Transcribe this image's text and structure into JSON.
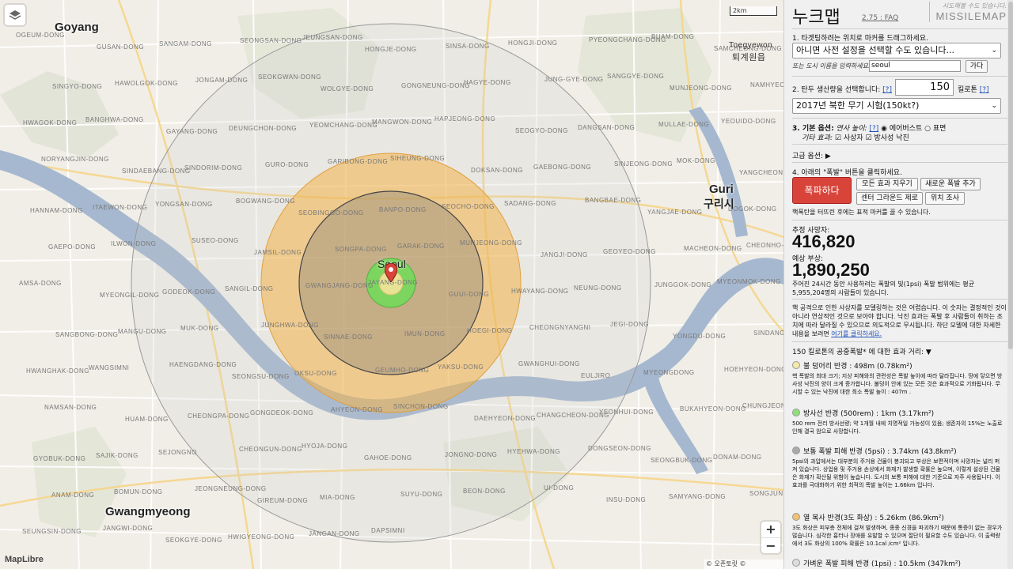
{
  "map": {
    "cities": {
      "goyang": "Goyang",
      "gwangmyeong": "Gwangmyeong",
      "guri_en": "Guri",
      "guri_ko": "구리시",
      "toegyewon_en": "Toegyewon",
      "toegyewon_ko": "퇴계원읍",
      "seoul": "Seoul"
    },
    "districts": [
      "OGEUM-DONG",
      "GUSAN-DONG",
      "SANGAM-DONG",
      "SEONGSAN-DONG",
      "JEUNGSAN-DONG",
      "HONGJE-DONG",
      "SINSA-DONG",
      "HONGJI-DONG",
      "PYEONGCHANG-DONG",
      "BUAM-DONG",
      "SAMCHEONG-DONG",
      "SINGYO-DONG",
      "HAWOLGOK-DONG",
      "JONGAM-DONG",
      "SEOKGWAN-DONG",
      "WOLGYE-DONG",
      "GONGNEUNG-DONG",
      "HAGYE-DONG",
      "JUNG-GYE-DONG",
      "SANGGYE-DONG",
      "MUNJEONG-DONG",
      "NAMHYEON-DONG",
      "HWAGOK-DONG",
      "BANGHWA-DONG",
      "GAYANG-DONG",
      "DEUNGCHON-DONG",
      "YEOMCHANG-DONG",
      "MANGWON-DONG",
      "HAPJEONG-DONG",
      "SEOGYO-DONG",
      "DANGSAN-DONG",
      "MULLAE-DONG",
      "YEOUIDO-DONG",
      "NORYANGJIN-DONG",
      "SINDAEBANG-DONG",
      "SINDORIM-DONG",
      "GURO-DONG",
      "GARIBONG-DONG",
      "SIHEUNG-DONG",
      "DOKSAN-DONG",
      "GAEBONG-DONG",
      "SINJEONG-DONG",
      "MOK-DONG",
      "YANGCHEON-GU",
      "HANNAM-DONG",
      "ITAEWON-DONG",
      "YONGSAN-DONG",
      "BOGWANG-DONG",
      "SEOBINGGO-DONG",
      "BANPO-DONG",
      "SEOCHO-DONG",
      "SADANG-DONG",
      "BANGBAE-DONG",
      "YANGJAE-DONG",
      "DOGOK-DONG",
      "GAEPO-DONG",
      "ILWON-DONG",
      "SUSEO-DONG",
      "JAMSIL-DONG",
      "SONGPA-DONG",
      "GARAK-DONG",
      "MUNJEONG-DONG",
      "JANGJI-DONG",
      "GEOYEO-DONG",
      "MACHEON-DONG",
      "CHEONHO-DONG",
      "AMSA-DONG",
      "MYEONGIL-DONG",
      "GODEOK-DONG",
      "SANGIL-DONG",
      "GWANGJANG-DONG",
      "JAYANG-DONG",
      "GUUI-DONG",
      "HWAYANG-DONG",
      "NEUNG-DONG",
      "JUNGGOK-DONG",
      "MYEONMOK-DONG",
      "SANGBONG-DONG",
      "MANGU-DONG",
      "MUK-DONG",
      "JUNGHWA-DONG",
      "SINNAE-DONG",
      "IMUN-DONG",
      "HOEGI-DONG",
      "CHEONGNYANGNI",
      "JEGI-DONG",
      "YONGDU-DONG",
      "SINDANG-DONG",
      "HWANGHAK-DONG",
      "WANGSIMNI",
      "HAENGDANG-DONG",
      "SEONGSU-DONG",
      "OKSU-DONG",
      "GEUMHO-DONG",
      "YAKSU-DONG",
      "GWANGHUI-DONG",
      "EULJIRO",
      "MYEONGDONG",
      "HOEHYEON-DONG",
      "NAMSAN-DONG",
      "HUAM-DONG",
      "CHEONGPA-DONG",
      "GONGDEOK-DONG",
      "AHYEON-DONG",
      "SINCHON-DONG",
      "DAEHYEON-DONG",
      "CHANGCHEON-DONG",
      "YEONHUI-DONG",
      "BUKAHYEON-DONG",
      "CHUNGJEONG-RO",
      "GYOBUK-DONG",
      "SAJIK-DONG",
      "SEJONGNO",
      "CHEONGUN-DONG",
      "HYOJA-DONG",
      "GAHOE-DONG",
      "JONGNO-DONG",
      "HYEHWA-DONG",
      "DONGSEON-DONG",
      "SEONGBUK-DONG",
      "DONAM-DONG",
      "ANAM-DONG",
      "BOMUN-DONG",
      "JEONGNEUNG-DONG",
      "GIREUM-DONG",
      "MIA-DONG",
      "SUYU-DONG",
      "BEON-DONG",
      "UI-DONG",
      "INSU-DONG",
      "SAMYANG-DONG",
      "SONGJUNG-DONG",
      "SEUNGSIN-DONG",
      "JANGWI-DONG",
      "SEOKGYE-DONG",
      "HWIGYEONG-DONG",
      "JANGAN-DONG",
      "DAPSIMNI"
    ],
    "marker_icon": "pin-marker-icon",
    "layers_icon": "layers-icon",
    "scale_label": "2km",
    "attribution": "© 오픈토릿 © OpenStreetMap",
    "maplibre_label": "MapLibre",
    "zoom_in": "+",
    "zoom_out": "−"
  },
  "panel": {
    "title": "누크맵",
    "version": "2.75 : FAQ",
    "slogan": "시도해볼 수도 있습니다.",
    "brand": "MISSILEMAP",
    "step1": "1. 타겟팅하려는 위치로 마커를 드래그하세요.",
    "preset_select": "아니면 사전 설정을 선택할 수도 있습니다...",
    "city_hint": "또는 도시 이름을 입력하세요.",
    "city_value": "seoul",
    "go_button": "가다",
    "step2": "2. 탄두 생산량을 선택합니다:",
    "step2_help": "[?]",
    "yield_value": "150",
    "yield_unit": "킬로톤",
    "yield_unit_help": "[?]",
    "weapon_select": "2017년 북한 무기 시험(150kt?)",
    "step3": "3. 기본 옵션:",
    "burst_height_label": "연사 높이:",
    "burst_help": "[?]",
    "airburst": "에어버스트",
    "surface": "표면",
    "other_effects": "기타 효과:",
    "casualties": "사상자",
    "fallout": "방사성 낙진",
    "advanced": "고급 옵션:",
    "advanced_arrow": "▶",
    "step4": "4. 아래의 \"폭발\" 버튼을 클릭하세요.",
    "detonate": "폭파하다",
    "clear_effects": "모든 효과 지우기",
    "add_detonation": "새로운 폭발 추가",
    "center_gz": "센터 그라운드 제로",
    "probe": "위치 조사",
    "drag_hint": "핵폭탄을 터뜨린 후에는 표적 마커를 끌 수 있습니다.",
    "est_fatalities_label": "추정 사망자:",
    "est_fatalities": "416,820",
    "injuries_label": "예상 부상:",
    "injuries": "1,890,250",
    "population_note": "주어진 24시간 동안 사용하려는 폭발의 빛(1psi) 폭발 범위에는 평균 5,955,204명의 사람들이 있습니다.",
    "modeling_note": "핵 공격으로 인한 사상자를 모델링하는 것은 어렵습니다. 이 숫자는 결정적인 것이 아니라 연상적인 것으로 보아야 합니다. 낙진 효과는 폭발 후 사람들이 취하는 조치에 따라 달라질 수 있으므로 의도적으로 무시됩니다. 하단 모델에 대한 자세한 내용을 보려면",
    "modeling_link": "여기를 클릭하세요.",
    "effects_header": "150 킬로톤의 공중폭발* 에 대한 효과 거리: ▼",
    "effects": [
      {
        "color": "#f5e9a8",
        "title": "불 덩어리 반경 : 498m (0.78km²)",
        "desc": "핵 폭발의 최대 크기; 지상 피해와의 관련성은 폭발 높이에 따라 달라집니다. 땅에 닿으면 방사성 낙진의 양이 크게 증가합니다. 불덩이 안에 있는 모든 것은 효과적으로 기화됩니다. 무시할 수 있는 낙진에 대한 최소 폭발 높이 : 407m ."
      },
      {
        "color": "#8fe07a",
        "title": "방사선 반경 (500rem) : 1km (3.17km²)",
        "desc": "500 rem 전리 방사선량; 약 1개월 내에 치명적일 가능성이 있음; 생존자의 15%는 노출로 인해 결국 암으로 사망합니다."
      },
      {
        "color": "#aaaaaa",
        "title": "보통 폭발 피해 반경 (5psi) : 3.74km (43.8km²)",
        "desc": "5psi의 과압에서는 대부분의 주거용 건물이 붕괴되고 부상은 보편적이며 사망자는 널리 퍼져 있습니다. 상업용 및 주거용 손상에서 화재가 발생할 확률은 높으며, 이렇게 설상된 건물은 화재가 확산될 위험이 높습니다. 도시의 보통 피해에 대한 기준으로 자주 사용됩니다. 이 효과를 극대화하기 위한 최적의 폭발 높이는 1.66km 입니다."
      },
      {
        "color": "#f2c173",
        "title": "열 복사 반경(3도 화상) : 5.26km (86.9km²)",
        "desc": "3도 화상은 피부층 전체에 걸쳐 발생하며, 종종 신경을 파괴하기 때문에 통증이 없는 경우가 많습니다. 심각한 흉터나 장애를 유발할 수 있으며 절단이 필요할 수도 있습니다. 이 출력량에서 3도 화상의 100% 확률은 10.1cal /cm² 입니다."
      },
      {
        "color": "#dddddd",
        "title": "가벼운 폭발 피해 반경 (1psi) : 10.5km (347km²)",
        "desc": ""
      }
    ]
  }
}
